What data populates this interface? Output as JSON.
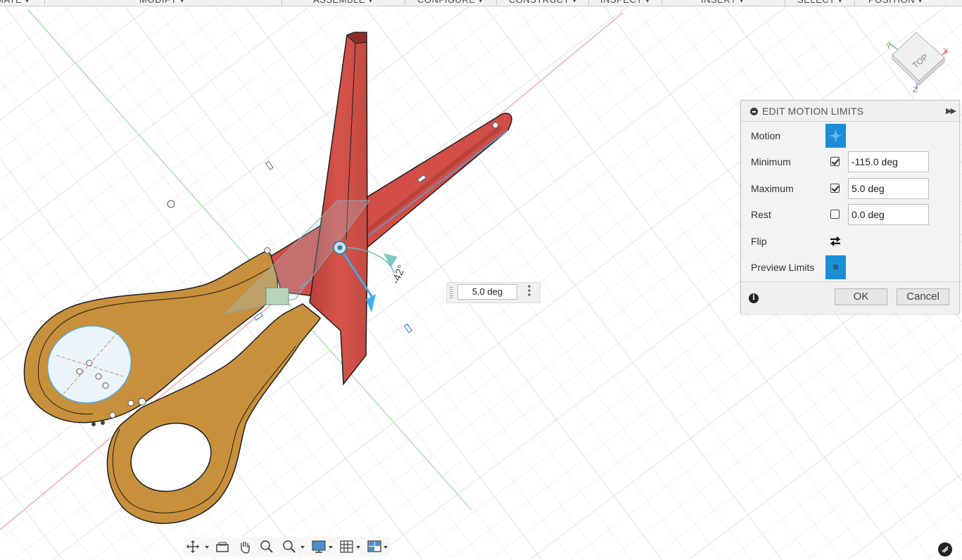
{
  "menu": {
    "items": [
      {
        "label": "MATE ▾"
      },
      {
        "label": "MODIFY ▾"
      },
      {
        "label": "ASSEMBLE ▾"
      },
      {
        "label": "CONFIGURE ▾"
      },
      {
        "label": "CONSTRUCT ▾"
      },
      {
        "label": "INSPECT ▾"
      },
      {
        "label": "INSERT ▾"
      },
      {
        "label": "SELECT ▾"
      },
      {
        "label": "POSITION ▾"
      }
    ]
  },
  "viewcube": {
    "face_label": "TOP",
    "axis_x": "X",
    "axis_y": "Y",
    "axis_z": "Z"
  },
  "canvas": {
    "angle_label": "-42°",
    "angle_input_value": "5.0 deg"
  },
  "dialog": {
    "title": "EDIT MOTION LIMITS",
    "motion_label": "Motion",
    "minimum_label": "Minimum",
    "minimum_checked": true,
    "minimum_value": "-115.0 deg",
    "maximum_label": "Maximum",
    "maximum_checked": true,
    "maximum_value": "5.0 deg",
    "rest_label": "Rest",
    "rest_checked": false,
    "rest_value": "0.0 deg",
    "flip_label": "Flip",
    "preview_label": "Preview Limits",
    "info_glyph": "i",
    "ok_label": "OK",
    "cancel_label": "Cancel"
  },
  "colors": {
    "blade": "#d24e46",
    "handle": "#c8903c",
    "accent": "#1a8fd6",
    "grid": "#d9d9d9"
  }
}
